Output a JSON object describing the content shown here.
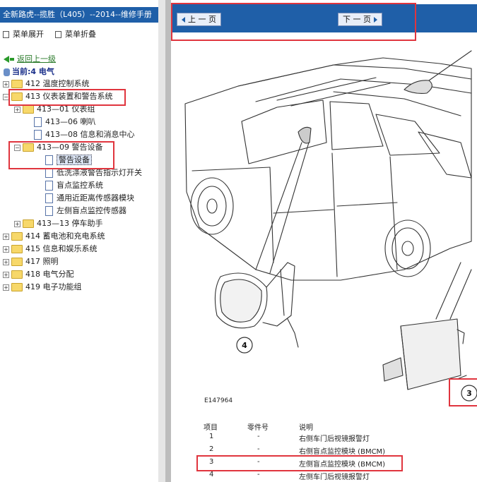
{
  "left_panel": {
    "title": "全新路虎--揽胜（L405）--2014--维修手册",
    "expand_label": "菜单展开",
    "collapse_label": "菜单折叠",
    "back_label": "返回上一级",
    "current_label": "当前:4 电气",
    "tree": [
      {
        "label": "412 温度控制系统",
        "toggle": "+",
        "icon": "folder"
      },
      {
        "label": "413 仪表装置和警告系统",
        "toggle": "−",
        "icon": "folder-open"
      },
      {
        "label": "413—01 仪表组",
        "toggle": "+",
        "icon": "folder"
      },
      {
        "label": "413—06 喇叭",
        "toggle": "",
        "icon": "doc"
      },
      {
        "label": "413—08 信息和消息中心",
        "toggle": "",
        "icon": "doc"
      },
      {
        "label": "413—09 警告设备",
        "toggle": "−",
        "icon": "folder-open"
      },
      {
        "label": "警告设备",
        "toggle": "",
        "icon": "doc"
      },
      {
        "label": "低洗涤液警告指示灯开关",
        "toggle": "",
        "icon": "doc"
      },
      {
        "label": "盲点监控系统",
        "toggle": "",
        "icon": "doc"
      },
      {
        "label": "通用近距离传感器模块",
        "toggle": "",
        "icon": "doc"
      },
      {
        "label": "左侧盲点监控传感器",
        "toggle": "",
        "icon": "doc"
      },
      {
        "label": "413—13 停车助手",
        "toggle": "+",
        "icon": "folder"
      },
      {
        "label": "414 蓄电池和充电系统",
        "toggle": "+",
        "icon": "folder"
      },
      {
        "label": "415 信息和娱乐系统",
        "toggle": "+",
        "icon": "folder"
      },
      {
        "label": "417 照明",
        "toggle": "+",
        "icon": "folder"
      },
      {
        "label": "418 电气分配",
        "toggle": "+",
        "icon": "folder"
      },
      {
        "label": "419 电子功能组",
        "toggle": "+",
        "icon": "folder"
      }
    ]
  },
  "main": {
    "prev_label": "上 一 页",
    "next_label": "下 一 页",
    "figure_code": "E147964",
    "callouts": [
      "4",
      "3"
    ],
    "table": {
      "headers": [
        "项目",
        "零件号",
        "说明"
      ],
      "rows": [
        [
          "1",
          "-",
          "右侧车门后视镜报警灯"
        ],
        [
          "2",
          "-",
          "右侧盲点监控模块 (BMCM)"
        ],
        [
          "3",
          "-",
          "左侧盲点监控模块 (BMCM)"
        ],
        [
          "4",
          "-",
          "左侧车门后视镜报警灯"
        ]
      ]
    }
  },
  "colors": {
    "title_bar": "#1f5fa8",
    "highlight_box": "#e0353e",
    "nav_bar": "#1f5fa8"
  }
}
